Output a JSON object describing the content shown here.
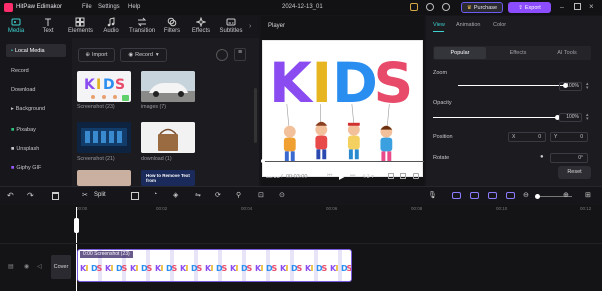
{
  "app": {
    "name": "HitPaw Edimakor",
    "menu": [
      "File",
      "Settings",
      "Help"
    ],
    "project_date": "2024-12-13_01",
    "purchase_label": "Purchase",
    "export_label": "Export"
  },
  "nav_tabs": [
    {
      "label": "Media",
      "icon": "media-icon",
      "active": true
    },
    {
      "label": "Text",
      "icon": "text-icon"
    },
    {
      "label": "Elements",
      "icon": "elements-icon"
    },
    {
      "label": "Audio",
      "icon": "audio-icon"
    },
    {
      "label": "Transition",
      "icon": "transition-icon"
    },
    {
      "label": "Filters",
      "icon": "filters-icon"
    },
    {
      "label": "Effects",
      "icon": "effects-icon"
    },
    {
      "label": "Subtitles",
      "icon": "subtitles-icon"
    }
  ],
  "sidebar": {
    "items": [
      {
        "label": "Local Media",
        "selected": true
      },
      {
        "label": "Record"
      },
      {
        "label": "Download"
      },
      {
        "label": "Background"
      },
      {
        "label": "Pixabay"
      },
      {
        "label": "Unsplash"
      },
      {
        "label": "Giphy GIF"
      }
    ]
  },
  "media": {
    "import_label": "Import",
    "record_label": "Record",
    "items": [
      {
        "label": "Screenshot (23)"
      },
      {
        "label": "images (7)"
      },
      {
        "label": "Screenshot (21)"
      },
      {
        "label": "download (1)"
      }
    ],
    "partial_thumb_text": "How to Remove Text from"
  },
  "player": {
    "title": "Player",
    "time_current": "00:00",
    "time_total": "00:03:00",
    "aspect": "4:3",
    "kids_letters": [
      "K",
      "I",
      "D",
      "S"
    ]
  },
  "properties": {
    "tabs": [
      "View",
      "Animation",
      "Color"
    ],
    "subtabs": [
      "Popular",
      "Effects",
      "AI Tools"
    ],
    "zoom_label": "Zoom",
    "zoom_value": "100%",
    "zoom_level": 1.0,
    "opacity_label": "Opacity",
    "opacity_value": "100%",
    "opacity_level": 1.0,
    "position_label": "Position",
    "pos_x_label": "X",
    "pos_x_value": "0",
    "pos_y_label": "Y",
    "pos_y_value": "0",
    "rotate_label": "Rotate",
    "rotate_value": "0°",
    "reset_label": "Reset"
  },
  "timeline": {
    "split_label": "Split",
    "ruler": [
      "00:00",
      "00:02",
      "00:04",
      "00:06",
      "00:08",
      "00:10",
      "00:12",
      "00:14",
      "00:16",
      "00:18"
    ],
    "cover_label": "Cover",
    "clip_label": "0:00 Screenshot (23)"
  },
  "colors": {
    "accent_teal": "#3fd1cf",
    "export_purple": "#8b4dff",
    "clip_purple": "#5b39b5"
  }
}
